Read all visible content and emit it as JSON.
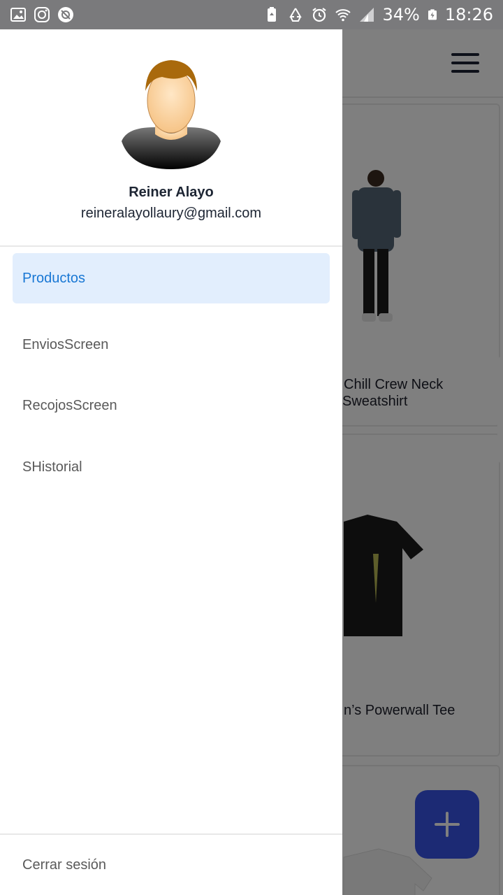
{
  "status_bar": {
    "battery_percent": "34%",
    "time": "18:26",
    "left_icons": [
      "gallery-icon",
      "instagram-icon",
      "no-signal-location-icon"
    ],
    "right_icons": [
      "battery-saver-icon",
      "recycle-icon",
      "alarm-icon",
      "wifi-icon",
      "cellular-signal-icon",
      "battery-icon"
    ]
  },
  "drawer": {
    "user": {
      "name": "Reiner Alayo",
      "email": "reineralayollaury@gmail.com"
    },
    "items": [
      {
        "label": "Productos",
        "active": true
      },
      {
        "label": "EnviosScreen",
        "active": false
      },
      {
        "label": "RecojosScreen",
        "active": false
      },
      {
        "label": "SHistorial",
        "active": false
      }
    ],
    "logout_label": "Cerrar sesión"
  },
  "background": {
    "products": [
      {
        "title_line1": "Chill Crew Neck",
        "title_line2": "Sweatshirt"
      },
      {
        "title_line1": "n’s Powerwall Tee"
      }
    ],
    "fab_icon": "plus-icon"
  },
  "colors": {
    "accent": "#1877d4",
    "active_bg": "#e2eefd",
    "fab": "#3955e8",
    "status_bar": "#7a7a7c"
  }
}
